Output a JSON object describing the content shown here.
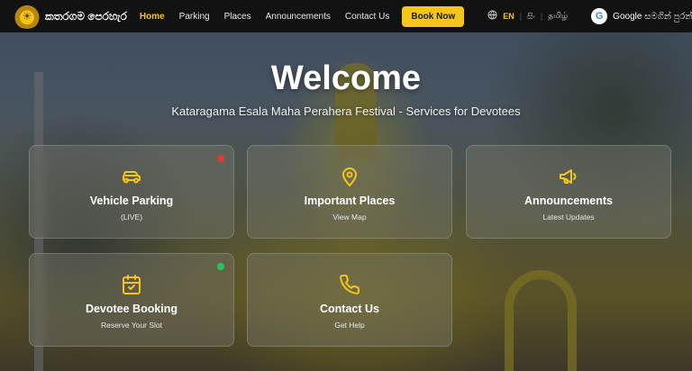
{
  "nav": {
    "logo_text": "කතරගම පෙරහැර",
    "links": [
      "Home",
      "Parking",
      "Places",
      "Announcements",
      "Contact Us"
    ],
    "active_index": 0,
    "book_label": "Book Now",
    "languages": [
      "EN",
      "සිං",
      "தமிழ்"
    ],
    "active_language": "EN",
    "google_label": "Google සමගින් පුරන්න"
  },
  "hero": {
    "title": "Welcome",
    "subtitle": "Kataragama Esala Maha Perahera Festival - Services for Devotees"
  },
  "cards": [
    {
      "title": "Vehicle Parking",
      "subtitle": "(LIVE)",
      "icon": "car-icon",
      "status": "red"
    },
    {
      "title": "Important Places",
      "subtitle": "View Map",
      "icon": "map-pin-icon"
    },
    {
      "title": "Announcements",
      "subtitle": "Latest Updates",
      "icon": "megaphone-icon"
    },
    {
      "title": "Devotee Booking",
      "subtitle": "Reserve Your Slot",
      "icon": "calendar-check-icon",
      "status": "green"
    },
    {
      "title": "Contact Us",
      "subtitle": "Get Help",
      "icon": "phone-icon"
    }
  ],
  "colors": {
    "accent": "#f5c518",
    "nav_bg": "#121212",
    "status_red": "#e53935",
    "status_green": "#22c55e"
  }
}
